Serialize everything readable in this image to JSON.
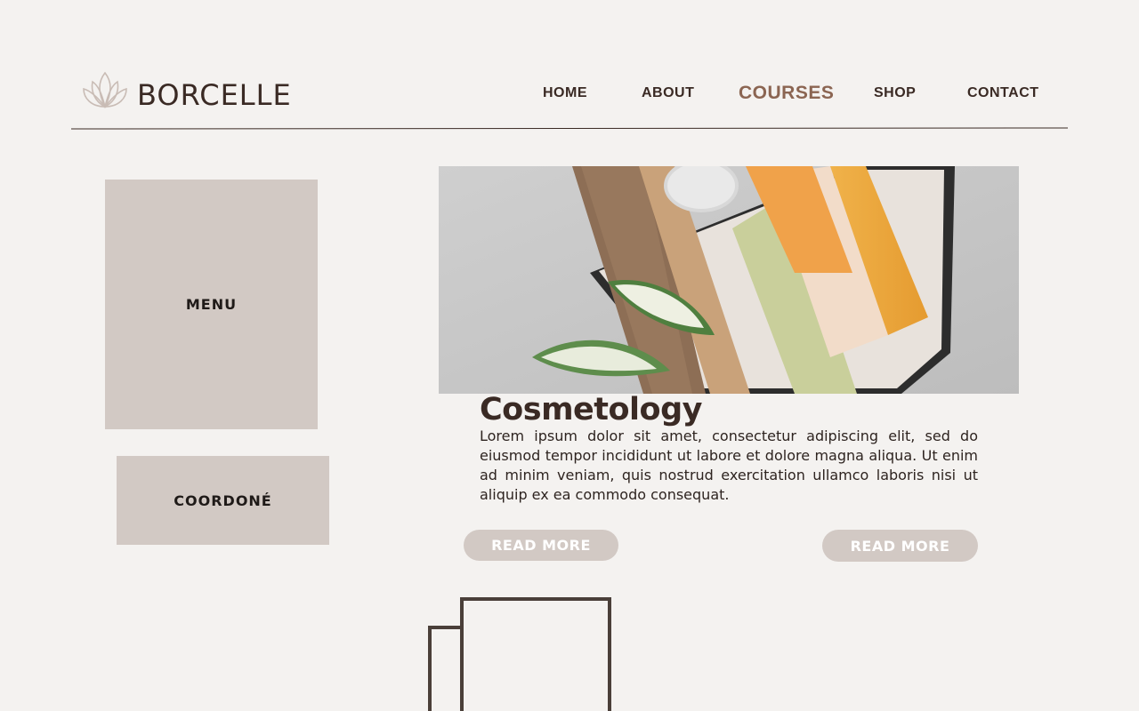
{
  "brand": {
    "name": "BORCELLE",
    "logo_icon": "lotus-icon"
  },
  "nav": {
    "items": [
      {
        "label": "HOME",
        "active": false
      },
      {
        "label": "ABOUT",
        "active": false
      },
      {
        "label": "COURSES",
        "active": true
      },
      {
        "label": "SHOP",
        "active": false
      },
      {
        "label": "CONTACT",
        "active": false
      }
    ]
  },
  "sidebar": {
    "menu_label": "MENU",
    "coordone_label": "COORDONÉ"
  },
  "article": {
    "title": "Cosmetology",
    "body": "Lorem ipsum dolor sit amet, consectetur adipiscing elit, sed do eiusmod tempor incididunt ut labore et dolore magna aliqua. Ut enim ad minim veniam, quis nostrud exercitation ullamco laboris nisi ut aliquip ex ea commodo consequat.",
    "read_more_1": "READ MORE",
    "read_more_2": "READ MORE"
  },
  "colors": {
    "background": "#f4f2f0",
    "text_dark": "#3a2a24",
    "accent": "#8b6552",
    "panel": "#d2c9c4"
  }
}
